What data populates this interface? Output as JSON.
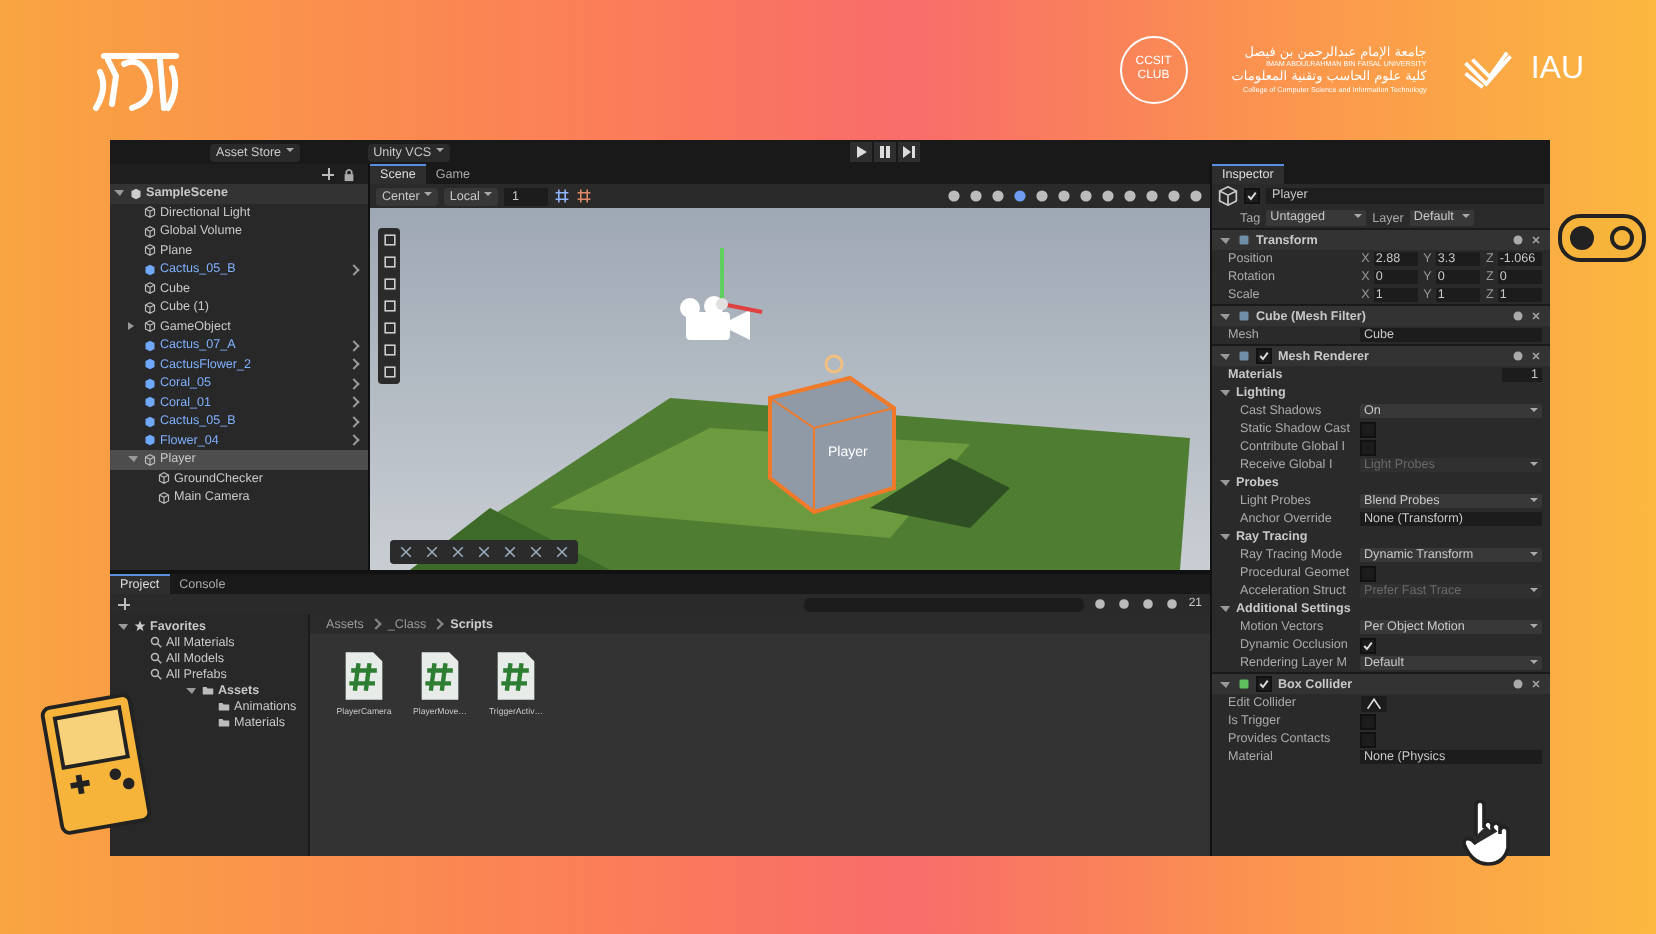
{
  "header": {
    "club_logo": [
      "CCSIT",
      "CLUB"
    ],
    "university": {
      "name_ar": "جامعة الإمام عبدالرحمن بن فيصل",
      "name_en": "IMAM ABDULRAHMAN BIN FAISAL UNIVERSITY",
      "college_ar": "كلية علوم الحاسب وتقنية المعلومات",
      "college_en": "College of Computer Science and Information Technology"
    },
    "brand": "IAU"
  },
  "toolbar": {
    "menus": [
      "Asset Store",
      "Unity VCS"
    ]
  },
  "hierarchy": {
    "items": [
      {
        "label": "SampleScene",
        "kind": "scene",
        "selected": false,
        "expanded": true,
        "children": [
          {
            "label": "Directional Light",
            "kind": "object",
            "selected": false
          },
          {
            "label": "Global Volume",
            "kind": "object",
            "selected": false
          },
          {
            "label": "Plane",
            "kind": "object",
            "selected": false
          },
          {
            "label": "Cactus_05_B",
            "kind": "prefab",
            "selected": false
          },
          {
            "label": "Cube",
            "kind": "object",
            "selected": false
          },
          {
            "label": "Cube (1)",
            "kind": "object",
            "selected": false
          },
          {
            "label": "GameObject",
            "kind": "object",
            "selected": false,
            "expanded": false
          },
          {
            "label": "Cactus_07_A",
            "kind": "prefab",
            "selected": false
          },
          {
            "label": "CactusFlower_2",
            "kind": "prefab",
            "selected": false
          },
          {
            "label": "Coral_05",
            "kind": "prefab",
            "selected": false
          },
          {
            "label": "Coral_01",
            "kind": "prefab",
            "selected": false
          },
          {
            "label": "Cactus_05_B",
            "kind": "prefab",
            "selected": false
          },
          {
            "label": "Flower_04",
            "kind": "prefab",
            "selected": false
          },
          {
            "label": "Player",
            "kind": "object",
            "selected": true,
            "expanded": true,
            "children": [
              {
                "label": "GroundChecker",
                "kind": "object",
                "selected": false
              },
              {
                "label": "Main Camera",
                "kind": "object",
                "selected": false
              }
            ]
          }
        ]
      }
    ]
  },
  "scene_view": {
    "tabs": [
      {
        "label": "Scene",
        "selected": true
      },
      {
        "label": "Game",
        "selected": false
      }
    ],
    "pivot": "Center",
    "space": "Local",
    "snap": "1",
    "object_label": "Player"
  },
  "project": {
    "tabs": [
      {
        "label": "Project",
        "selected": true
      },
      {
        "label": "Console",
        "selected": false
      }
    ],
    "count": "21",
    "tree": [
      {
        "label": "Favorites",
        "kind": "favorites",
        "selected": false,
        "expanded": true,
        "children": [
          {
            "label": "All Materials",
            "kind": "search",
            "selected": false
          },
          {
            "label": "All Models",
            "kind": "search",
            "selected": false
          },
          {
            "label": "All Prefabs",
            "kind": "search",
            "selected": false
          }
        ]
      },
      {
        "label": "Assets",
        "kind": "folder",
        "selected": false,
        "expanded": true,
        "children": [
          {
            "label": "Animations",
            "kind": "folder",
            "selected": false
          },
          {
            "label": "Materials",
            "kind": "folder",
            "selected": false
          }
        ]
      }
    ],
    "breadcrumb": [
      "Assets",
      "_Class",
      "Scripts"
    ],
    "files": [
      {
        "name": "PlayerCamera"
      },
      {
        "name": "PlayerMove…"
      },
      {
        "name": "TriggerActiv…"
      }
    ]
  },
  "inspector": {
    "tab": "Inspector",
    "object": {
      "name": "Player",
      "active": true,
      "tag_label": "Tag",
      "tag": "Untagged",
      "layer_label": "Layer",
      "layer": "Default"
    },
    "components": [
      {
        "title": "Transform",
        "rows": [
          {
            "kind": "vector",
            "label": "Position",
            "values": [
              {
                "axis": "X",
                "value": "2.88"
              },
              {
                "axis": "Y",
                "value": "3.3"
              },
              {
                "axis": "Z",
                "value": "-1.066"
              }
            ]
          },
          {
            "kind": "vector",
            "label": "Rotation",
            "values": [
              {
                "axis": "X",
                "value": "0"
              },
              {
                "axis": "Y",
                "value": "0"
              },
              {
                "axis": "Z",
                "value": "0"
              }
            ]
          },
          {
            "kind": "vector",
            "label": "Scale",
            "values": [
              {
                "axis": "X",
                "value": "1"
              },
              {
                "axis": "Y",
                "value": "1"
              },
              {
                "axis": "Z",
                "value": "1"
              }
            ]
          }
        ]
      },
      {
        "title": "Cube (Mesh Filter)",
        "rows": [
          {
            "kind": "object",
            "label": "Mesh",
            "value": "Cube"
          }
        ]
      },
      {
        "title": "Mesh Renderer",
        "enabled": true,
        "rows": [
          {
            "kind": "count",
            "label": "Materials",
            "value": "1"
          },
          {
            "kind": "section",
            "label": "Lighting",
            "expanded": true
          },
          {
            "kind": "dropdown",
            "label": "Cast Shadows",
            "value": "On",
            "disabled": false
          },
          {
            "kind": "checkbox",
            "label": "Static Shadow Cast",
            "checked": false
          },
          {
            "kind": "checkbox",
            "label": "Contribute Global I",
            "checked": false
          },
          {
            "kind": "dropdown",
            "label": "Receive Global I",
            "value": "Light Probes",
            "disabled": true
          },
          {
            "kind": "section",
            "label": "Probes",
            "expanded": true
          },
          {
            "kind": "dropdown",
            "label": "Light Probes",
            "value": "Blend Probes",
            "disabled": false
          },
          {
            "kind": "object",
            "label": "Anchor Override",
            "value": "None (Transform)"
          },
          {
            "kind": "section",
            "label": "Ray Tracing",
            "expanded": true
          },
          {
            "kind": "dropdown",
            "label": "Ray Tracing Mode",
            "value": "Dynamic Transform",
            "disabled": false
          },
          {
            "kind": "checkbox",
            "label": "Procedural Geomet",
            "checked": false
          },
          {
            "kind": "dropdown",
            "label": "Acceleration Struct",
            "value": "Prefer Fast Trace",
            "disabled": true
          },
          {
            "kind": "section",
            "label": "Additional Settings",
            "expanded": true
          },
          {
            "kind": "dropdown",
            "label": "Motion Vectors",
            "value": "Per Object Motion",
            "disabled": false
          },
          {
            "kind": "checkbox",
            "label": "Dynamic Occlusion",
            "checked": true
          },
          {
            "kind": "dropdown",
            "label": "Rendering Layer M",
            "value": "Default",
            "disabled": false
          }
        ]
      },
      {
        "title": "Box Collider",
        "enabled": true,
        "rows": [
          {
            "kind": "button",
            "label": "Edit Collider"
          },
          {
            "kind": "checkbox",
            "label": "Is Trigger",
            "checked": false
          },
          {
            "kind": "checkbox",
            "label": "Provides Contacts",
            "checked": false
          },
          {
            "kind": "object",
            "label": "Material",
            "value": "None (Physics"
          }
        ]
      }
    ]
  }
}
